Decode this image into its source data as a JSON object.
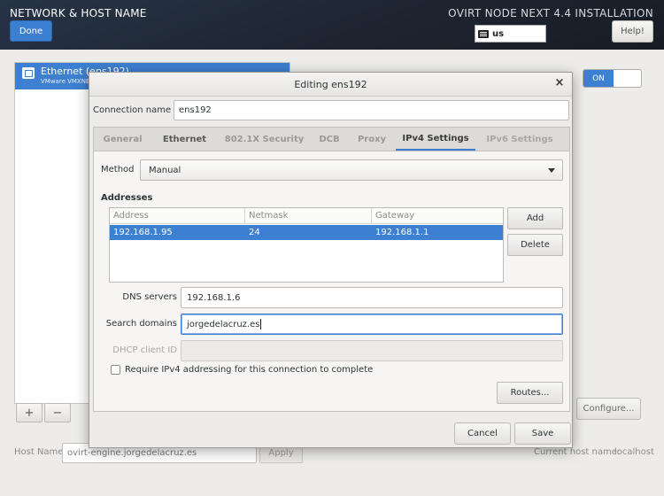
{
  "header": {
    "title": "NETWORK & HOST NAME",
    "product": "OVIRT NODE NEXT 4.4 INSTALLATION",
    "done_label": "Done",
    "keyboard_layout": "us",
    "help_label": "Help!"
  },
  "hub": {
    "device_name": "Ethernet (ens192)",
    "device_sub": "VMware VMXNET3",
    "add_label": "+",
    "remove_label": "−",
    "toggle_label": "ON",
    "configure_label": "Configure...",
    "host_name_label": "Host Name:",
    "host_name_value": "ovirt-engine.jorgedelacruz.es",
    "apply_label": "Apply",
    "current_host_label": "Current host name:",
    "current_host_value": "localhost"
  },
  "dialog": {
    "title": "Editing ens192",
    "close_symbol": "×",
    "connection_name_label": "Connection name",
    "connection_name_value": "ens192",
    "tabs": [
      {
        "label": "General"
      },
      {
        "label": "Ethernet"
      },
      {
        "label": "802.1X Security"
      },
      {
        "label": "DCB"
      },
      {
        "label": "Proxy"
      },
      {
        "label": "IPv4 Settings"
      },
      {
        "label": "IPv6 Settings"
      }
    ],
    "method_label": "Method",
    "method_value": "Manual",
    "addresses_title": "Addresses",
    "columns": [
      "Address",
      "Netmask",
      "Gateway"
    ],
    "rows": [
      {
        "address": "192.168.1.95",
        "netmask": "24",
        "gateway": "192.168.1.1"
      }
    ],
    "add_label": "Add",
    "delete_label": "Delete",
    "dns_label": "DNS servers",
    "dns_value": "192.168.1.6",
    "search_label": "Search domains",
    "search_value": "jorgedelacruz.es",
    "dhcp_label": "DHCP client ID",
    "dhcp_value": "",
    "require_label": "Require IPv4 addressing for this connection to complete",
    "routes_label": "Routes...",
    "cancel_label": "Cancel",
    "save_label": "Save"
  }
}
